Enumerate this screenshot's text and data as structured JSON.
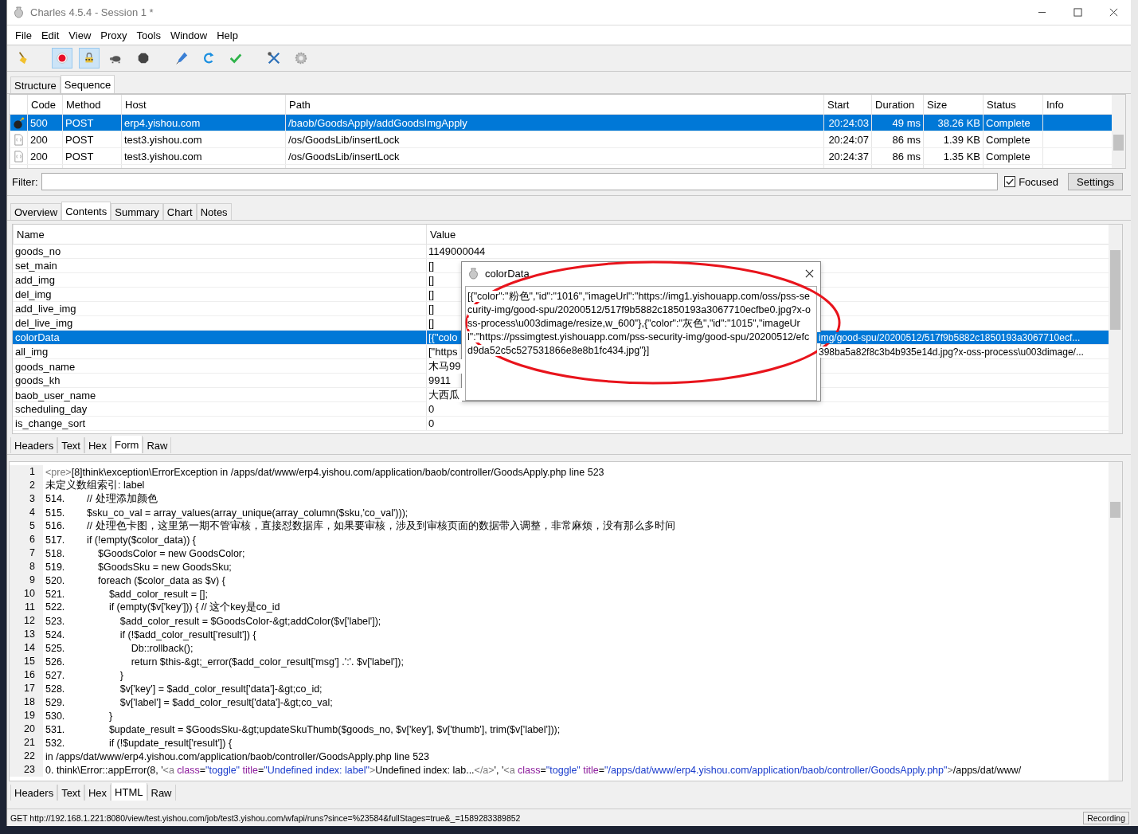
{
  "window": {
    "title": "Charles 4.5.4 - Session 1 *"
  },
  "menu": [
    "File",
    "Edit",
    "View",
    "Proxy",
    "Tools",
    "Window",
    "Help"
  ],
  "toolbar": [
    {
      "kind": "broom"
    },
    {
      "kind": "record",
      "on": true
    },
    {
      "kind": "throttle",
      "on": true
    },
    {
      "kind": "turtle",
      "on": false
    },
    {
      "kind": "stop",
      "on": false
    },
    {
      "kind": "pen"
    },
    {
      "kind": "refresh"
    },
    {
      "kind": "check"
    },
    {
      "kind": "tools"
    },
    {
      "kind": "gear"
    }
  ],
  "view_tabs": [
    {
      "label": "Structure",
      "selected": false
    },
    {
      "label": "Sequence",
      "selected": true
    }
  ],
  "requests": {
    "columns": [
      "Code",
      "Method",
      "Host",
      "Path",
      "Start",
      "Duration",
      "Size",
      "Status",
      "Info"
    ],
    "rows": [
      {
        "kind": "error",
        "selected": true,
        "code": "500",
        "method": "POST",
        "host": "erp4.yishou.com",
        "path": "/baob/GoodsApply/addGoodsImgApply",
        "start": "20:24:03",
        "duration": "49 ms",
        "size": "38.26 KB",
        "status": "Complete"
      },
      {
        "kind": "json",
        "selected": false,
        "code": "200",
        "method": "POST",
        "host": "test3.yishou.com",
        "path": "/os/GoodsLib/insertLock",
        "start": "20:24:07",
        "duration": "86 ms",
        "size": "1.39 KB",
        "status": "Complete"
      },
      {
        "kind": "json",
        "selected": false,
        "code": "200",
        "method": "POST",
        "host": "test3.yishou.com",
        "path": "/os/GoodsLib/insertLock",
        "start": "20:24:37",
        "duration": "86 ms",
        "size": "1.35 KB",
        "status": "Complete"
      }
    ]
  },
  "filter": {
    "label": "Filter:",
    "focused": {
      "label": "Focused",
      "checked": true
    },
    "settings": "Settings"
  },
  "detail_tabs": [
    {
      "label": "Overview",
      "selected": false
    },
    {
      "label": "Contents",
      "selected": true
    },
    {
      "label": "Summary",
      "selected": false
    },
    {
      "label": "Chart",
      "selected": false
    },
    {
      "label": "Notes",
      "selected": false
    }
  ],
  "form": {
    "columns": [
      "Name",
      "Value"
    ],
    "rows": [
      {
        "name": "goods_no",
        "value": "1149000044",
        "selected": false
      },
      {
        "name": "set_main",
        "value": "[]",
        "selected": false
      },
      {
        "name": "add_img",
        "value": "[]",
        "selected": false
      },
      {
        "name": "del_img",
        "value": "[]",
        "selected": false
      },
      {
        "name": "add_live_img",
        "value": "[]",
        "selected": false
      },
      {
        "name": "del_live_img",
        "value": "[]",
        "selected": false
      },
      {
        "name": "colorData",
        "value": "[{\"colo",
        "value_after": "img/good-spu/20200512/517f9b5882c1850193a3067710ecf...",
        "selected": true
      },
      {
        "name": "all_img",
        "value": "[\"https",
        "value_after": "398ba5a82f8c3b4b935e14d.jpg?x-oss-process\\u003dimage/...",
        "selected": false
      },
      {
        "name": "goods_name",
        "value": "木马99",
        "selected": false
      },
      {
        "name": "goods_kh",
        "value": "9911",
        "selected": false
      },
      {
        "name": "baob_user_name",
        "value": "大西瓜",
        "selected": false
      },
      {
        "name": "scheduling_day",
        "value": "0",
        "selected": false
      },
      {
        "name": "is_change_sort",
        "value": "0",
        "selected": false
      }
    ]
  },
  "request_tabs": [
    {
      "label": "Headers",
      "selected": false
    },
    {
      "label": "Text",
      "selected": false
    },
    {
      "label": "Hex",
      "selected": false
    },
    {
      "label": "Form",
      "selected": true
    },
    {
      "label": "Raw",
      "selected": false
    }
  ],
  "popup": {
    "title": "colorData",
    "text": "[{\"color\":\"粉色\",\"id\":\"1016\",\"imageUrl\":\"https://img1.yishouapp.com/oss/pss-security-img/good-spu/20200512/517f9b5882c1850193a3067710ecfbe0.jpg?x-oss-process\\u003dimage/resize,w_600\"},{\"color\":\"灰色\",\"id\":\"1015\",\"imageUrl\":\"https://pssimgtest.yishouapp.com/pss-security-img/good-spu/20200512/efcd9da52c5c527531866e8e8b1fc434.jpg\"}]"
  },
  "response": {
    "lines": [
      {
        "number": "1",
        "segments": [
          {
            "t": "<pre>",
            "kind": "tag"
          },
          {
            "t": "[8]think\\exception\\ErrorException in /apps/dat/www/erp4.yishou.com/application/baob/controller/GoodsApply.php line 523",
            "kind": "plain"
          }
        ]
      },
      {
        "number": "2",
        "segments": [
          {
            "t": "未定义数组索引: label",
            "kind": "plain"
          }
        ]
      },
      {
        "number": "3",
        "segments": [
          {
            "t": "514.        // 处理添加颜色",
            "kind": "plain"
          }
        ]
      },
      {
        "number": "4",
        "segments": [
          {
            "t": "515.        $sku_co_val = array_values(array_unique(array_column($sku,'co_val')));",
            "kind": "plain"
          }
        ]
      },
      {
        "number": "5",
        "segments": [
          {
            "t": "516.        // 处理色卡图，这里第一期不管审核，直接怼数据库，如果要审核，涉及到审核页面的数据带入调整，非常麻烦，没有那么多时间",
            "kind": "plain"
          }
        ]
      },
      {
        "number": "6",
        "segments": [
          {
            "t": "517.        if (!empty($color_data)) {",
            "kind": "plain"
          }
        ]
      },
      {
        "number": "7",
        "segments": [
          {
            "t": "518.            $GoodsColor = new GoodsColor;",
            "kind": "plain"
          }
        ]
      },
      {
        "number": "8",
        "segments": [
          {
            "t": "519.            $GoodsSku = new GoodsSku;",
            "kind": "plain"
          }
        ]
      },
      {
        "number": "9",
        "segments": [
          {
            "t": "520.            foreach ($color_data as $v) {",
            "kind": "plain"
          }
        ]
      },
      {
        "number": "10",
        "segments": [
          {
            "t": "521.                $add_color_result = [];",
            "kind": "plain"
          }
        ]
      },
      {
        "number": "11",
        "segments": [
          {
            "t": "522.                if (empty($v['key'])) { // 这个key是co_id",
            "kind": "plain"
          }
        ]
      },
      {
        "number": "12",
        "segments": [
          {
            "t": "523.                    $add_color_result = $GoodsColor-&gt;addColor($v['label']);",
            "kind": "plain"
          }
        ]
      },
      {
        "number": "13",
        "segments": [
          {
            "t": "524.                    if (!$add_color_result['result']) {",
            "kind": "plain"
          }
        ]
      },
      {
        "number": "14",
        "segments": [
          {
            "t": "525.                        Db::rollback();",
            "kind": "plain"
          }
        ]
      },
      {
        "number": "15",
        "segments": [
          {
            "t": "526.                        return $this-&gt;_error($add_color_result['msg'] .':'. $v['label']);",
            "kind": "plain"
          }
        ]
      },
      {
        "number": "16",
        "segments": [
          {
            "t": "527.                    }",
            "kind": "plain"
          }
        ]
      },
      {
        "number": "17",
        "segments": [
          {
            "t": "528.                    $v['key'] = $add_color_result['data']-&gt;co_id;",
            "kind": "plain"
          }
        ]
      },
      {
        "number": "18",
        "segments": [
          {
            "t": "529.                    $v['label'] = $add_color_result['data']-&gt;co_val;",
            "kind": "plain"
          }
        ]
      },
      {
        "number": "19",
        "segments": [
          {
            "t": "530.                }",
            "kind": "plain"
          }
        ]
      },
      {
        "number": "20",
        "segments": [
          {
            "t": "531.                $update_result = $GoodsSku-&gt;updateSkuThumb($goods_no, $v['key'], $v['thumb'], trim($v['label']));",
            "kind": "plain"
          }
        ]
      },
      {
        "number": "21",
        "segments": [
          {
            "t": "532.                if (!$update_result['result']) {",
            "kind": "plain"
          }
        ]
      },
      {
        "number": "22",
        "segments": [
          {
            "t": "in /apps/dat/www/erp4.yishou.com/application/baob/controller/GoodsApply.php line 523",
            "kind": "plain"
          }
        ]
      },
      {
        "number": "23",
        "segments": [
          {
            "t": "0. think\\Error::appError(8, '",
            "kind": "plain"
          },
          {
            "t": "<a ",
            "kind": "tag"
          },
          {
            "t": "class",
            "kind": "attr"
          },
          {
            "t": "=",
            "kind": "plain"
          },
          {
            "t": "\"toggle\"",
            "kind": "string"
          },
          {
            "t": " title",
            "kind": "attr"
          },
          {
            "t": "=",
            "kind": "plain"
          },
          {
            "t": "\"Undefined index: label\"",
            "kind": "string"
          },
          {
            "t": ">",
            "kind": "tag"
          },
          {
            "t": "Undefined index: lab...",
            "kind": "plain"
          },
          {
            "t": "</a>",
            "kind": "tag"
          },
          {
            "t": "', '",
            "kind": "plain"
          },
          {
            "t": "<a ",
            "kind": "tag"
          },
          {
            "t": "class",
            "kind": "attr"
          },
          {
            "t": "=",
            "kind": "plain"
          },
          {
            "t": "\"toggle\"",
            "kind": "string"
          },
          {
            "t": " title",
            "kind": "attr"
          },
          {
            "t": "=",
            "kind": "plain"
          },
          {
            "t": "\"/apps/dat/www/erp4.yishou.com/application/baob/controller/GoodsApply.php\"",
            "kind": "string"
          },
          {
            "t": ">",
            "kind": "tag"
          },
          {
            "t": "/apps/dat/www/",
            "kind": "plain"
          }
        ]
      }
    ]
  },
  "response_tabs": [
    {
      "label": "Headers",
      "selected": false
    },
    {
      "label": "Text",
      "selected": false
    },
    {
      "label": "Hex",
      "selected": false
    },
    {
      "label": "HTML",
      "selected": true
    },
    {
      "label": "Raw",
      "selected": false
    }
  ],
  "status_bar": {
    "text": "GET http://192.168.1.221:8080/view/test.yishou.com/job/test3.yishou.com/wfapi/runs?since=%23584&fullStages=true&_=1589283389852",
    "recording": "Recording"
  }
}
